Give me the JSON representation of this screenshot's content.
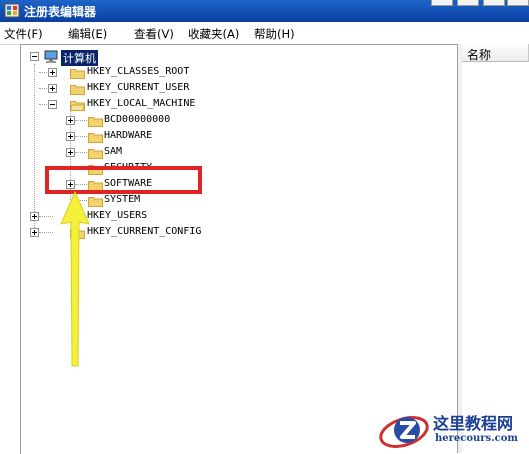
{
  "window": {
    "title": "注册表编辑器"
  },
  "menu": {
    "items": [
      "文件(F)",
      "编辑(E)",
      "查看(V)",
      "收藏夹(A)",
      "帮助(H)"
    ]
  },
  "tree": {
    "root": "计算机",
    "nodes": [
      {
        "label": "HKEY_CLASSES_ROOT",
        "expanded": false
      },
      {
        "label": "HKEY_CURRENT_USER",
        "expanded": false
      },
      {
        "label": "HKEY_LOCAL_MACHINE",
        "expanded": true
      },
      {
        "label": "BCD00000000",
        "expanded": false
      },
      {
        "label": "HARDWARE",
        "expanded": false
      },
      {
        "label": "SAM",
        "expanded": false
      },
      {
        "label": "SECURITY",
        "expanded": false
      },
      {
        "label": "SOFTWARE",
        "expanded": false
      },
      {
        "label": "SYSTEM",
        "expanded": false
      },
      {
        "label": "HKEY_USERS",
        "expanded": false
      },
      {
        "label": "HKEY_CURRENT_CONFIG",
        "expanded": false
      }
    ]
  },
  "list_pane": {
    "column_name": "名称"
  },
  "annotations": {
    "highlight_color": "#e02323",
    "arrow_color": "#f5f03a"
  },
  "watermark": {
    "title": "这里教程网",
    "url": "herecours.com"
  }
}
